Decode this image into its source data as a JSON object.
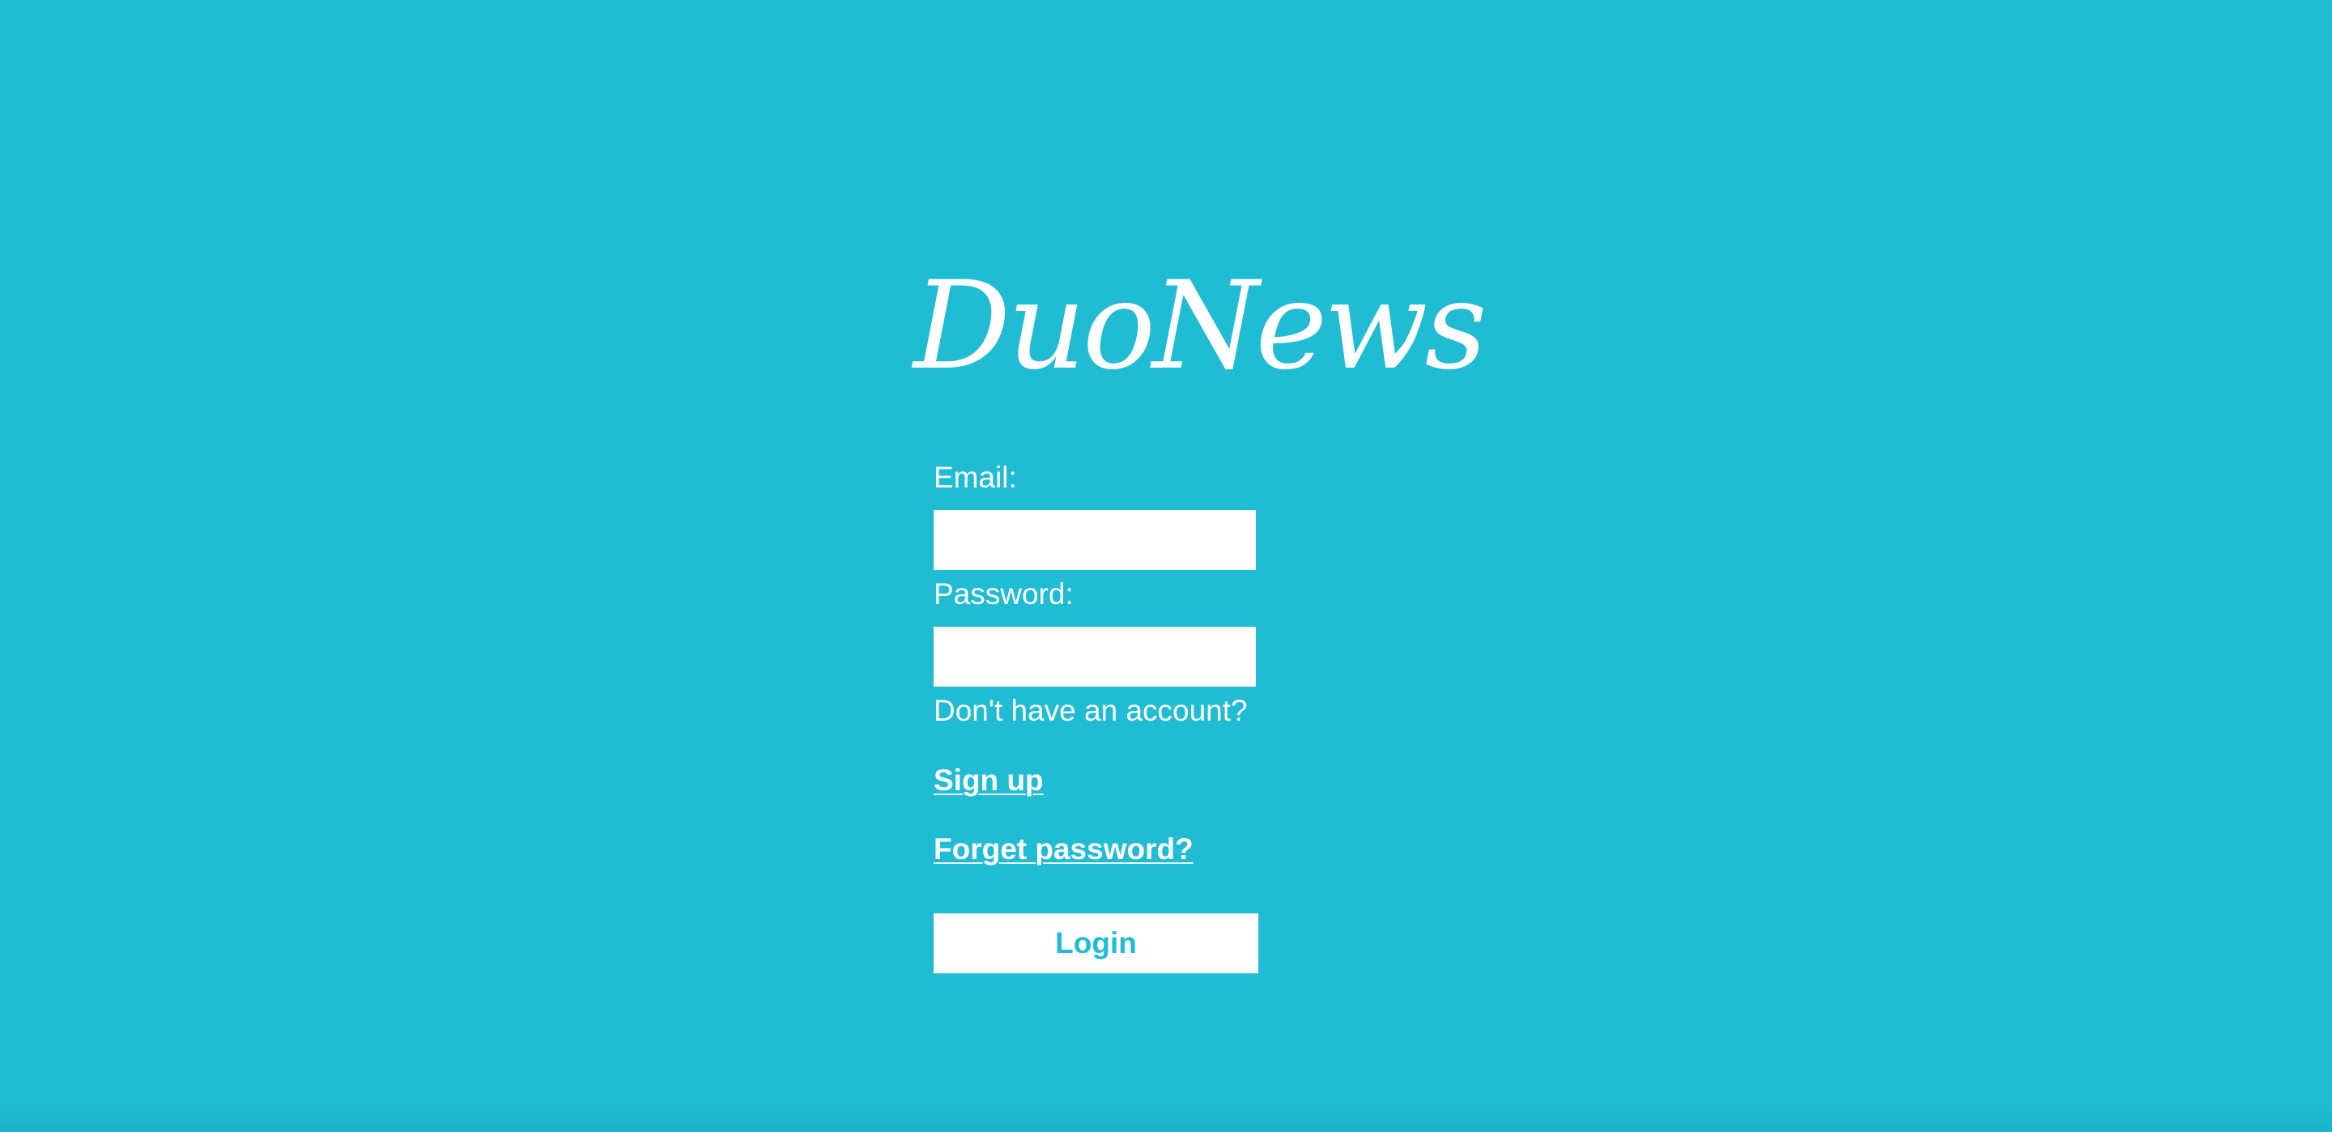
{
  "app": {
    "logo_text": "DuoNews"
  },
  "login_form": {
    "email_label": "Email:",
    "email_value": "",
    "email_placeholder": "",
    "password_label": "Password:",
    "password_value": "",
    "password_placeholder": "",
    "no_account_text": "Don't have an account?",
    "signup_link": "Sign up",
    "forgot_link": "Forget password?",
    "login_button": "Login"
  },
  "colors": {
    "background": "#1fbcd4",
    "text": "#ffffff",
    "button_text": "#1fbcd4"
  }
}
